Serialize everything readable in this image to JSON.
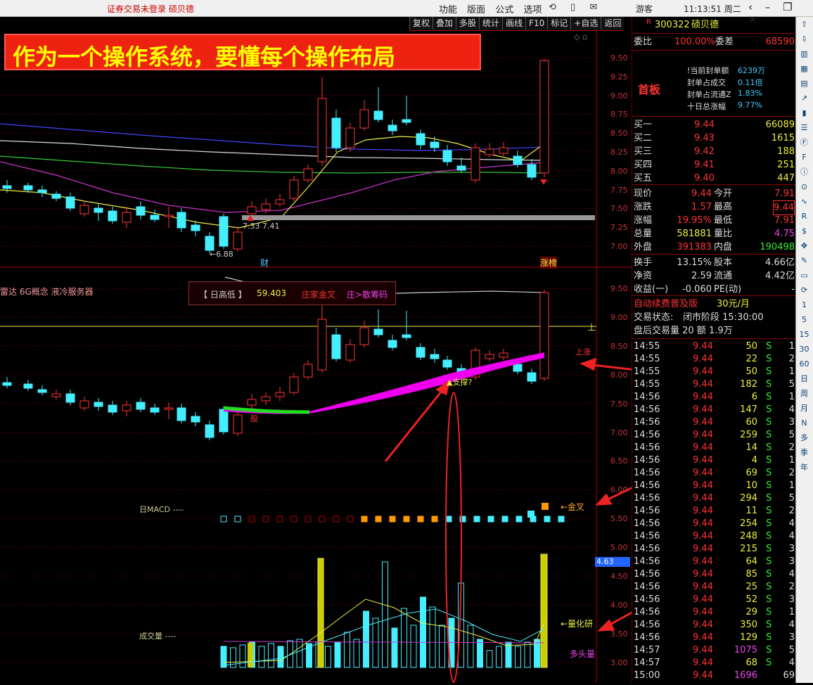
{
  "titlebar": {
    "title": "证券交易未登录  硕贝德",
    "menu": [
      "功能",
      "版面",
      "公式",
      "选项"
    ],
    "icons": [
      "refresh-icon",
      "phone-icon",
      "mail-icon"
    ],
    "user": "游客",
    "clock": "11:13:51 周二",
    "window_buttons": [
      "back-icon",
      "minimize-icon",
      "maximize-icon",
      "close-icon"
    ]
  },
  "toolbar": [
    "复权",
    "叠加",
    "多股",
    "统计",
    "画线",
    "F10",
    "标记",
    "+自选",
    "返回"
  ],
  "banner": "作为一个操作系统，要懂每个操作布局",
  "chart_labels": {
    "low_label": "←6.88",
    "range_label": "7.33 7.41",
    "cai": "财",
    "zhangting": "涨榜",
    "lower_panel_title": "雷达 6G概念 液冷服务器",
    "daily_box": "【 日高低 】",
    "daily_value": "59.403",
    "daily_tag1": "庄家金叉",
    "daily_tag2": "庄>散筹码",
    "support": "▲支撑?",
    "shang": "上",
    "shang_zhang": "上涨",
    "gu": "股",
    "macd_label": "日MACD ----",
    "jincha": "←金叉",
    "volume_label": "成交量 ----",
    "lianghua": "←量化研",
    "duotou": "多头量",
    "price_tag": "4.63"
  },
  "upper_ticks": [
    "9.50",
    "9.25",
    "9.00",
    "8.75",
    "8.50",
    "8.25",
    "8.00",
    "7.75",
    "7.50",
    "7.25",
    "7.00"
  ],
  "lower_ticks": [
    "9.50",
    "9.00",
    "8.50",
    "8.00",
    "7.50",
    "7.00",
    "6.50",
    "6.00",
    "5.50",
    "5.00",
    "4.50",
    "4.00",
    "3.50",
    "3.00"
  ],
  "stock": {
    "code": "300322",
    "name": "硕贝德",
    "badge": "R"
  },
  "weibi": {
    "label1": "委比",
    "val1": "100.00%",
    "label2": "委差",
    "val2": "68590"
  },
  "fengdan": {
    "tag": "首板",
    "lines": [
      {
        "label": "!当前封单额",
        "value": "6239万"
      },
      {
        "label": "封单占成交",
        "value": "0.11倍"
      },
      {
        "label": "封单占流通Z",
        "value": "1.83%"
      },
      {
        "label": "十日总涨幅",
        "value": "9.77%"
      }
    ]
  },
  "bids": [
    {
      "label": "买一",
      "price": "9.44",
      "vol": "66089"
    },
    {
      "label": "买二",
      "price": "9.43",
      "vol": "1615"
    },
    {
      "label": "买三",
      "price": "9.42",
      "vol": "188"
    },
    {
      "label": "买四",
      "price": "9.41",
      "vol": "251"
    },
    {
      "label": "买五",
      "price": "9.40",
      "vol": "447"
    }
  ],
  "quote": [
    {
      "l1": "现价",
      "v1": "9.44",
      "l2": "今开",
      "v2": "7.91"
    },
    {
      "l1": "涨跌",
      "v1": "1.57",
      "l2": "最高",
      "v2": "9.44"
    },
    {
      "l1": "涨幅",
      "v1": "19.95%",
      "l2": "最低",
      "v2": "7.91"
    },
    {
      "l1": "总量",
      "v1": "581881",
      "l2": "量比",
      "v2": "4.75"
    },
    {
      "l1": "外盘",
      "v1": "391383",
      "l2": "内盘",
      "v2": "190498"
    }
  ],
  "fund": [
    {
      "l1": "换手",
      "v1": "13.15%",
      "l2": "股本",
      "v2": "4.66亿"
    },
    {
      "l1": "净资",
      "v1": "2.59",
      "l2": "流通",
      "v2": "4.42亿"
    },
    {
      "l1": "收益(一)",
      "v1": "-0.060",
      "l2": "PE(动)",
      "v2": "-"
    }
  ],
  "promo": {
    "text": "自动续费普及版",
    "price": "30元/月"
  },
  "status": {
    "label": "交易状态:",
    "value": "闭市阶段 15:30:00"
  },
  "after": "盘后交易量 20 额 1.9万",
  "ticks": [
    {
      "t": "14:55",
      "p": "9.44",
      "v": "50",
      "s": "S",
      "n": "1"
    },
    {
      "t": "14:55",
      "p": "9.44",
      "v": "22",
      "s": "S",
      "n": "2"
    },
    {
      "t": "14:55",
      "p": "9.44",
      "v": "50",
      "s": "S",
      "n": "1"
    },
    {
      "t": "14:55",
      "p": "9.44",
      "v": "182",
      "s": "S",
      "n": "5"
    },
    {
      "t": "14:56",
      "p": "9.44",
      "v": "6",
      "s": "S",
      "n": "1"
    },
    {
      "t": "14:56",
      "p": "9.44",
      "v": "147",
      "s": "S",
      "n": "4"
    },
    {
      "t": "14:56",
      "p": "9.44",
      "v": "60",
      "s": "S",
      "n": "3"
    },
    {
      "t": "14:56",
      "p": "9.44",
      "v": "259",
      "s": "S",
      "n": "5"
    },
    {
      "t": "14:56",
      "p": "9.44",
      "v": "14",
      "s": "S",
      "n": "2"
    },
    {
      "t": "14:56",
      "p": "9.44",
      "v": "4",
      "s": "S",
      "n": "1"
    },
    {
      "t": "14:56",
      "p": "9.44",
      "v": "69",
      "s": "S",
      "n": "2"
    },
    {
      "t": "14:56",
      "p": "9.44",
      "v": "10",
      "s": "S",
      "n": "1"
    },
    {
      "t": "14:56",
      "p": "9.44",
      "v": "294",
      "s": "S",
      "n": "5"
    },
    {
      "t": "14:56",
      "p": "9.44",
      "v": "11",
      "s": "S",
      "n": "2"
    },
    {
      "t": "14:56",
      "p": "9.44",
      "v": "254",
      "s": "S",
      "n": "4"
    },
    {
      "t": "14:56",
      "p": "9.44",
      "v": "248",
      "s": "S",
      "n": "4"
    },
    {
      "t": "14:56",
      "p": "9.44",
      "v": "215",
      "s": "S",
      "n": "3"
    },
    {
      "t": "14:56",
      "p": "9.44",
      "v": "64",
      "s": "S",
      "n": "3"
    },
    {
      "t": "14:56",
      "p": "9.44",
      "v": "85",
      "s": "S",
      "n": "4"
    },
    {
      "t": "14:56",
      "p": "9.44",
      "v": "25",
      "s": "S",
      "n": "2"
    },
    {
      "t": "14:56",
      "p": "9.44",
      "v": "52",
      "s": "S",
      "n": "3"
    },
    {
      "t": "14:56",
      "p": "9.44",
      "v": "29",
      "s": "S",
      "n": "1"
    },
    {
      "t": "14:56",
      "p": "9.44",
      "v": "350",
      "s": "S",
      "n": "4"
    },
    {
      "t": "14:56",
      "p": "9.44",
      "v": "129",
      "s": "S",
      "n": "3"
    },
    {
      "t": "14:57",
      "p": "9.44",
      "v": "1075",
      "s": "S",
      "n": "5"
    },
    {
      "t": "14:57",
      "p": "9.44",
      "v": "68",
      "s": "S",
      "n": "4"
    },
    {
      "t": "15:00",
      "p": "9.44",
      "v": "1696",
      "s": "",
      "n": "69"
    }
  ],
  "sidebar": [
    "1",
    "5",
    "15",
    "30",
    "60",
    "日",
    "周",
    "月",
    "N",
    "多",
    "季",
    "年"
  ]
}
